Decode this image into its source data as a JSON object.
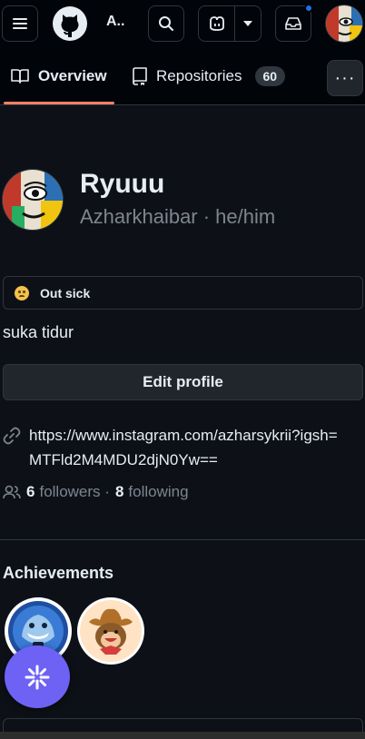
{
  "topbar": {
    "context_label": "A..",
    "menu_icon": "hamburger-icon",
    "logo_icon": "github-logo-icon",
    "search_icon": "search-icon",
    "copilot_icon": "copilot-icon",
    "dropdown_icon": "chevron-down-icon",
    "inbox_icon": "inbox-icon",
    "notification_color": "#1f6feb"
  },
  "tabs": {
    "overview_label": "Overview",
    "repositories_label": "Repositories",
    "repositories_count": "60",
    "more_label": "···",
    "active_color": "#f78166"
  },
  "profile": {
    "name": "Ryuuu",
    "handle": "Azharkhaibar · he/him",
    "status_text": "Out sick",
    "bio": "suka tidur",
    "edit_label": "Edit profile",
    "link": "https://www.instagram.com/azharsykrii?igsh=MTFld2M4MDU2djN0Yw==",
    "followers_count": "6",
    "followers_label": "followers ·",
    "following_count": "8",
    "following_label": "following"
  },
  "achievements": {
    "title": "Achievements"
  },
  "fab": {
    "icon": "sparkle-icon",
    "color": "#6e62f5"
  }
}
